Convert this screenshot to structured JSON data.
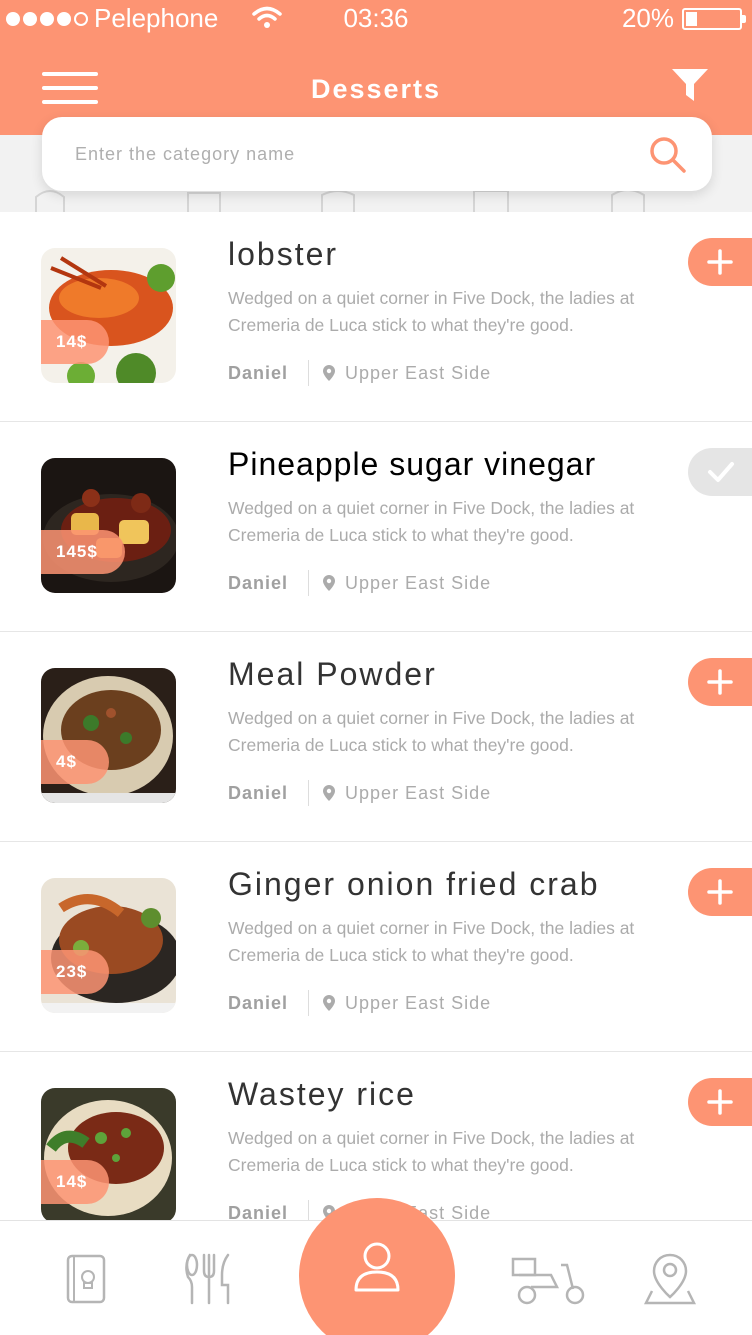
{
  "status_bar": {
    "carrier": "Pelephone",
    "time": "03:36",
    "battery": "20%"
  },
  "header": {
    "title": "Desserts"
  },
  "search": {
    "placeholder": "Enter the category name"
  },
  "items": [
    {
      "name": "lobster",
      "price": "14$",
      "description": "Wedged on a quiet corner in Five Dock, the ladies at Cremeria de Luca stick to what they're good.",
      "author": "Daniel",
      "location": "Upper East Side",
      "added": false
    },
    {
      "name": "Pineapple sugar vinegar",
      "price": "145$",
      "description": "Wedged on a quiet corner in Five Dock, the ladies at Cremeria de Luca stick to what they're good.",
      "author": "Daniel",
      "location": "Upper East Side",
      "added": true
    },
    {
      "name": "Meal Powder",
      "price": "4$",
      "description": "Wedged on a quiet corner in Five Dock, the ladies at Cremeria de Luca stick to what they're good.",
      "author": "Daniel",
      "location": "Upper East Side",
      "added": false
    },
    {
      "name": "Ginger onion fried crab",
      "price": "23$",
      "description": "Wedged on a quiet corner in Five Dock, the ladies at Cremeria de Luca stick to what they're good.",
      "author": "Daniel",
      "location": "Upper East Side",
      "added": false
    },
    {
      "name": "Wastey rice",
      "price": "14$",
      "description": "Wedged on a quiet corner in Five Dock, the ladies at Cremeria de Luca stick to what they're good.",
      "author": "Daniel",
      "location": "Upper East Side",
      "added": false
    }
  ],
  "tabbar": {
    "tabs": [
      "recipe-book-icon",
      "cutlery-icon",
      "user-icon",
      "delivery-scooter-icon",
      "map-pin-icon"
    ],
    "active": "user-icon"
  },
  "colors": {
    "accent": "#FD9473",
    "text_dark": "#333333",
    "text_muted": "#ABABAB",
    "check_bg": "#E5E5E5"
  }
}
